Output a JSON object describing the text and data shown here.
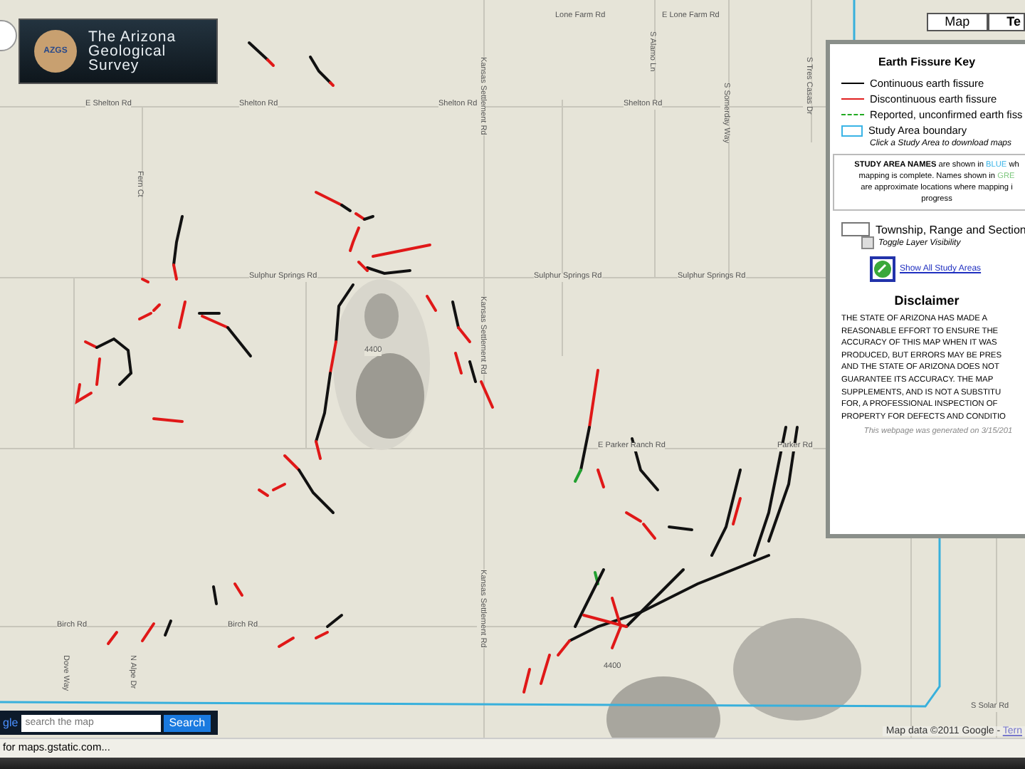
{
  "header": {
    "logo_title": [
      "The Arizona",
      "Geological",
      "Survey"
    ],
    "logo_badge": "AZGS"
  },
  "map_type_buttons": [
    {
      "label": "Map",
      "selected": false
    },
    {
      "label": "Te",
      "selected": true
    }
  ],
  "road_labels": [
    {
      "text": "E Shelton Rd"
    },
    {
      "text": "Shelton Rd"
    },
    {
      "text": "Shelton Rd"
    },
    {
      "text": "Shelton Rd"
    },
    {
      "text": "Lone Farm Rd"
    },
    {
      "text": "E Lone Farm Rd"
    },
    {
      "text": "Sulphur Springs Rd"
    },
    {
      "text": "Sulphur Springs Rd"
    },
    {
      "text": "Sulphur Springs Rd"
    },
    {
      "text": "E Parker Ranch Rd"
    },
    {
      "text": "Parker Rd"
    },
    {
      "text": "Birch Rd"
    },
    {
      "text": "Birch Rd"
    },
    {
      "text": "S Solar Rd"
    },
    {
      "text": "Fern Ct"
    },
    {
      "text": "Kansas Settlement Rd"
    },
    {
      "text": "Kansas Settlement Rd"
    },
    {
      "text": "Kansas Settlement Rd"
    },
    {
      "text": "S Alamo Ln"
    },
    {
      "text": "S Somerday Way"
    },
    {
      "text": "S Tres Casas Dr"
    },
    {
      "text": "Dove Way"
    },
    {
      "text": "N Alpe Dr"
    }
  ],
  "contour_labels": [
    "4400",
    "4400"
  ],
  "legend": {
    "title": "Earth Fissure Key",
    "items": [
      {
        "kind": "continuous",
        "label": "Continuous earth fissure"
      },
      {
        "kind": "discontinuous",
        "label": "Discontinuous earth fissure"
      },
      {
        "kind": "reported",
        "label": "Reported, unconfirmed earth fiss"
      },
      {
        "kind": "boundary",
        "label": "Study Area boundary",
        "note": "Click a Study Area to download maps"
      }
    ]
  },
  "study_area_note": [
    [
      {
        "kind": "heading",
        "text": "STUDY AREA NAMES"
      },
      {
        "kind": "text",
        "text": " are shown in "
      },
      {
        "kind": "complete",
        "text": "BLUE"
      },
      {
        "kind": "text",
        "text": " wh"
      }
    ],
    [
      {
        "kind": "text",
        "text": "mapping is complete. Names shown in "
      },
      {
        "kind": "in_progress",
        "text": "GRE"
      }
    ],
    [
      {
        "kind": "text",
        "text": "are approximate locations where mapping i"
      }
    ],
    [
      {
        "kind": "text",
        "text": "progress"
      }
    ]
  ],
  "township_layer": {
    "label": "Township, Range and Section",
    "toggle_label": "Toggle Layer Visibility",
    "checked": false
  },
  "show_all_link": "Show All Study Areas",
  "disclaimer": {
    "title": "Disclaimer",
    "lines": [
      "THE STATE OF ARIZONA HAS MADE A",
      "REASONABLE EFFORT TO ENSURE THE",
      "ACCURACY OF THIS MAP WHEN IT WAS",
      "PRODUCED, BUT ERRORS MAY BE PRES",
      "AND THE STATE OF ARIZONA DOES NOT",
      "GUARANTEE ITS ACCURACY. THE MAP",
      "SUPPLEMENTS, AND IS NOT A SUBSTITU",
      "FOR, A PROFESSIONAL INSPECTION OF",
      "PROPERTY FOR DEFECTS AND CONDITIO"
    ],
    "generated": "This webpage was generated on 3/15/201"
  },
  "search": {
    "logo": "gle",
    "placeholder": "search the map",
    "button": "Search"
  },
  "attribution": {
    "text": "Map data ©2011 Google - ",
    "link": "Tern"
  },
  "status_bar": "for maps.gstatic.com..."
}
